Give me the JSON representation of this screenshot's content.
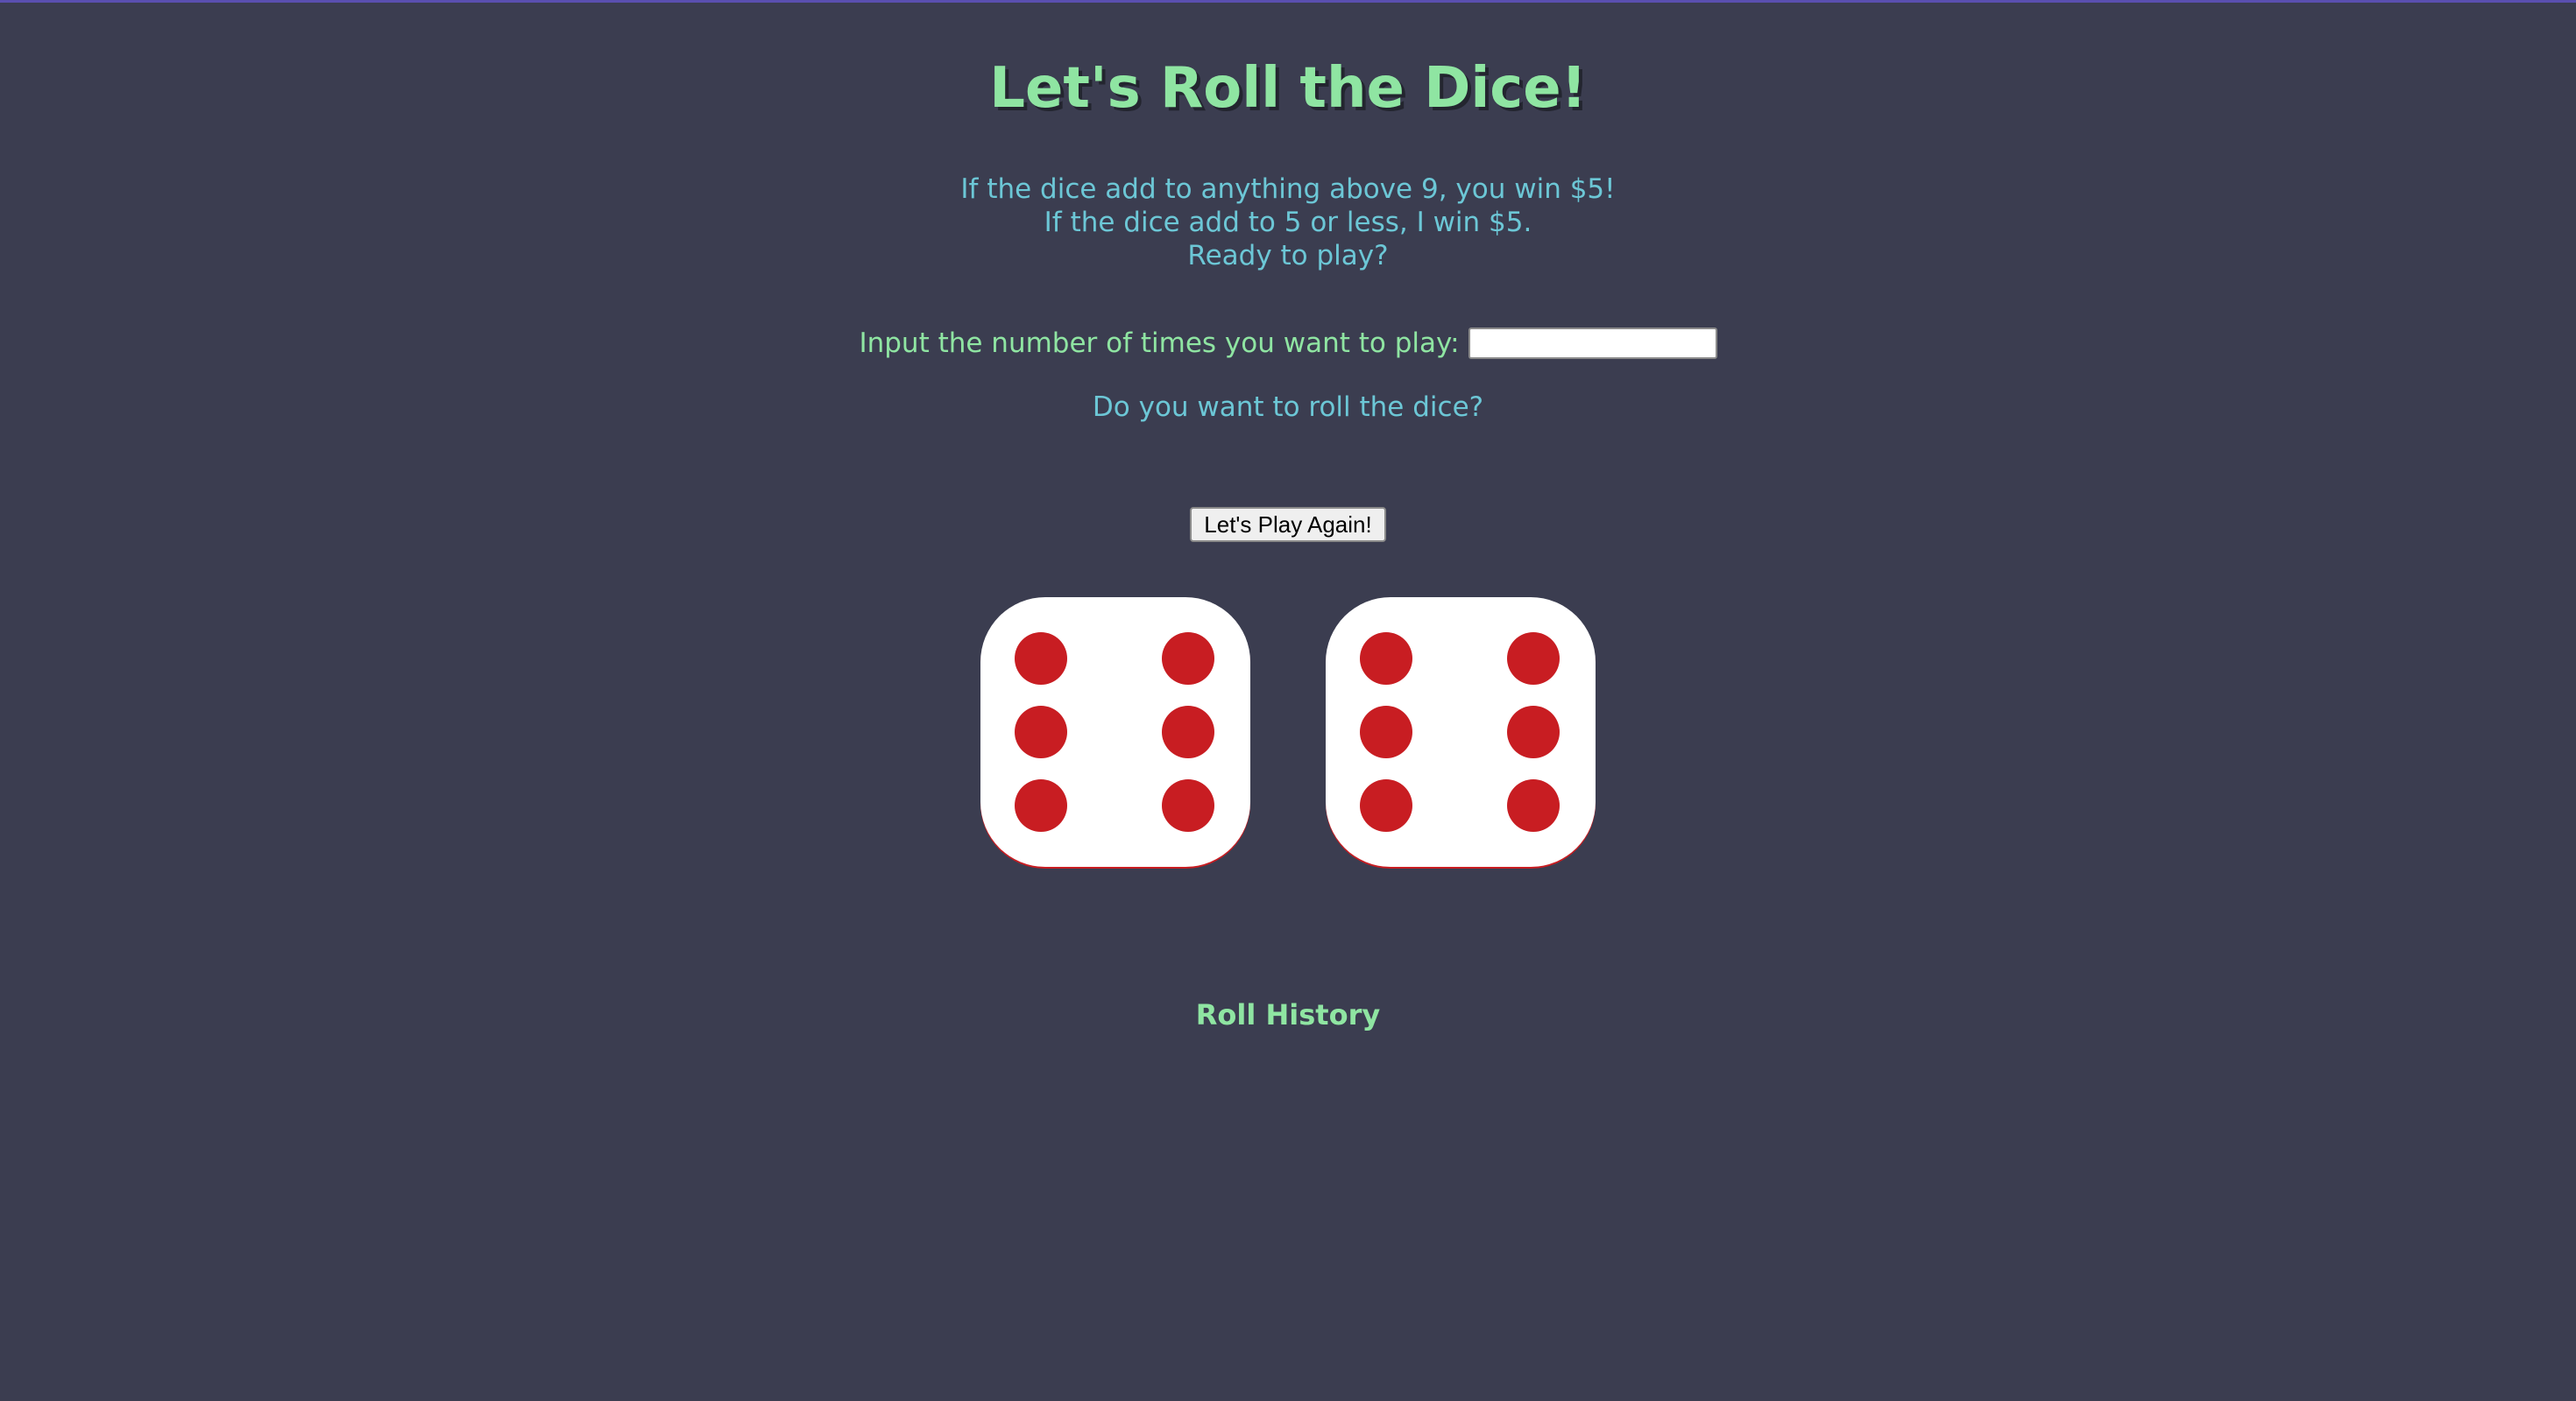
{
  "header": {
    "title": "Let's Roll the Dice!"
  },
  "rules": {
    "line1": "If the dice add to anything above 9, you win $5!",
    "line2": "If the dice add to 5 or less, I win $5.",
    "line3": "Ready to play?"
  },
  "play_input": {
    "label": "Input the number of times you want to play:",
    "value": "",
    "placeholder": ""
  },
  "prompt": "Do you want to roll the dice?",
  "play_button": {
    "label": "Let's Play Again!"
  },
  "dice": [
    {
      "value": 6
    },
    {
      "value": 6
    }
  ],
  "colors": {
    "background": "#3b3d50",
    "title_green": "#8fe5a2",
    "text_cyan": "#6cc7d6",
    "pip_red": "#c81d22",
    "die_white": "#ffffff"
  },
  "history": {
    "heading": "Roll History"
  }
}
